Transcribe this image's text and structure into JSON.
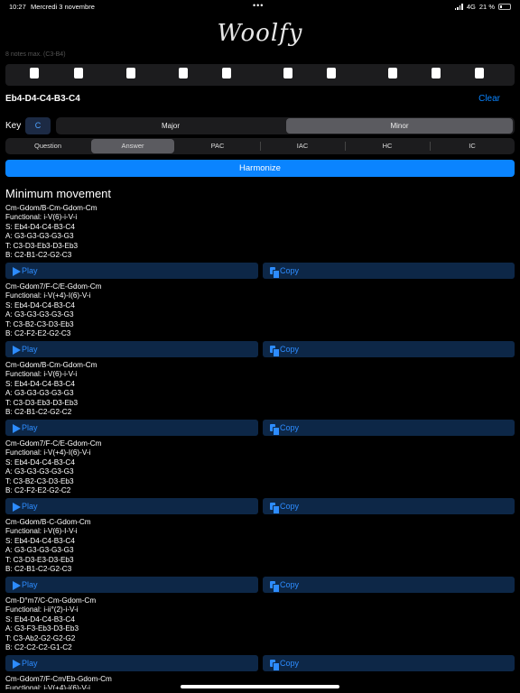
{
  "status": {
    "time": "10:27",
    "date": "Mercredi 3 novembre",
    "network": "4G",
    "battery": "21 %",
    "battery_level": 0.21
  },
  "app": {
    "logo": "Woolfy",
    "hint": "8 notes max. (C3-B4)"
  },
  "input": {
    "notes": "Eb4-D4-C4-B3-C4",
    "clear_label": "Clear"
  },
  "key": {
    "label": "Key",
    "value": "C"
  },
  "mode": {
    "options": [
      "Major",
      "Minor"
    ],
    "selected": "Minor"
  },
  "tabs": {
    "items": [
      "Question",
      "Answer",
      "PAC",
      "IAC",
      "HC",
      "IC"
    ],
    "selected": "Answer"
  },
  "harmonize_label": "Harmonize",
  "section_title": "Minimum movement",
  "actions": {
    "play": "Play",
    "copy": "Copy"
  },
  "results": [
    {
      "chords": "Cm-Gdom/B-Cm-Gdom-Cm",
      "functional": "Functional: i-V(6)-i-V-i",
      "s": "S: Eb4-D4-C4-B3-C4",
      "a": "A: G3-G3-G3-G3-G3",
      "t": "T: C3-D3-Eb3-D3-Eb3",
      "b": "B: C2-B1-C2-G2-C3"
    },
    {
      "chords": "Cm-Gdom7/F-C/E-Gdom-Cm",
      "functional": "Functional: i-V(+4)-I(6)-V-i",
      "s": "S: Eb4-D4-C4-B3-C4",
      "a": "A: G3-G3-G3-G3-G3",
      "t": "T: C3-B2-C3-D3-Eb3",
      "b": "B: C2-F2-E2-G2-C3"
    },
    {
      "chords": "Cm-Gdom/B-Cm-Gdom-Cm",
      "functional": "Functional: i-V(6)-i-V-i",
      "s": "S: Eb4-D4-C4-B3-C4",
      "a": "A: G3-G3-G3-G3-G3",
      "t": "T: C3-D3-Eb3-D3-Eb3",
      "b": "B: C2-B1-C2-G2-C2"
    },
    {
      "chords": "Cm-Gdom7/F-C/E-Gdom-Cm",
      "functional": "Functional: i-V(+4)-I(6)-V-i",
      "s": "S: Eb4-D4-C4-B3-C4",
      "a": "A: G3-G3-G3-G3-G3",
      "t": "T: C3-B2-C3-D3-Eb3",
      "b": "B: C2-F2-E2-G2-C2"
    },
    {
      "chords": "Cm-Gdom/B-C-Gdom-Cm",
      "functional": "Functional: i-V(6)-I-V-i",
      "s": "S: Eb4-D4-C4-B3-C4",
      "a": "A: G3-G3-G3-G3-G3",
      "t": "T: C3-D3-E3-D3-Eb3",
      "b": "B: C2-B1-C2-G2-C3"
    },
    {
      "chords": "Cm-D°m7/C-Cm-Gdom-Cm",
      "functional": "Functional: i-ii°(2)-i-V-i",
      "s": "S: Eb4-D4-C4-B3-C4",
      "a": "A: G3-F3-Eb3-D3-Eb3",
      "t": "T: C3-Ab2-G2-G2-G2",
      "b": "B: C2-C2-C2-G1-C2"
    },
    {
      "chords": "Cm-Gdom7/F-Cm/Eb-Gdom-Cm",
      "functional": "Functional: i-V(+4)-i(6)-V-i"
    }
  ]
}
